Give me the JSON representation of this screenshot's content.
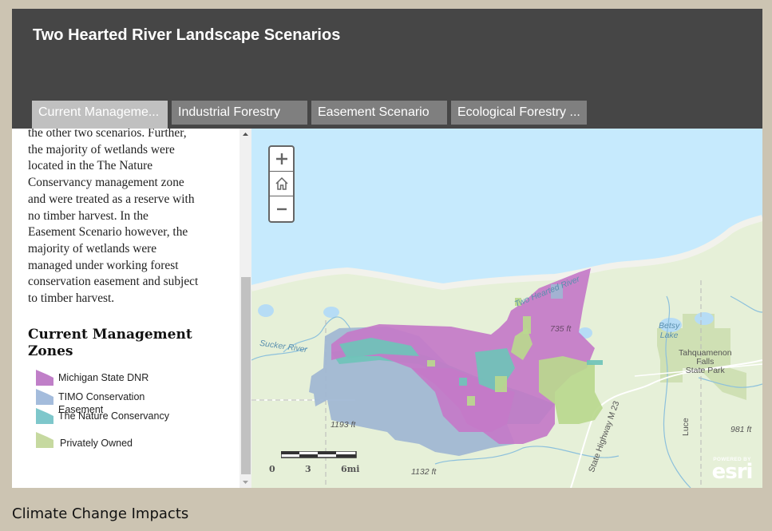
{
  "header": {
    "title": "Two Hearted River Landscape Scenarios"
  },
  "tabs": [
    {
      "label": "Current Manageme...",
      "active": true
    },
    {
      "label": "Industrial Forestry",
      "active": false
    },
    {
      "label": "Easement Scenario",
      "active": false
    },
    {
      "label": "Ecological Forestry ...",
      "active": false
    }
  ],
  "side_panel": {
    "narrative_lines": [
      "the other two scenarios.  Further,",
      "the majority of wetlands were",
      "located in the The Nature",
      "Conservancy management zone",
      "and were treated as a reserve with",
      "no timber harvest.  In the",
      "Easement Scenario however, the",
      "majority of wetlands were",
      "managed under working forest",
      "conservation easement and subject",
      "to timber harvest."
    ],
    "legend_title_line1": "Current Management",
    "legend_title_line2": "Zones",
    "legend": [
      {
        "label": "Michigan State DNR",
        "color": "#c07fc8"
      },
      {
        "label": "TIMO Conservation Easement",
        "color": "#a4bcdc"
      },
      {
        "label": "The Nature Conservancy",
        "color": "#7ec7cb"
      },
      {
        "label": "Privately Owned",
        "color": "#c6d9a0"
      }
    ],
    "scroll_position": 0.42
  },
  "map": {
    "zoom_in_icon": "plus-icon",
    "home_icon": "home-icon",
    "zoom_out_icon": "minus-icon",
    "labels": {
      "river_two_hearted": "Two Hearted River",
      "river_sucker": "Sucker River",
      "elev_735": "735 ft",
      "elev_1193": "1193 ft",
      "elev_1132": "1132 ft",
      "elev_981": "981 ft",
      "lake_betsy_1": "Betsy",
      "lake_betsy_2": "Lake",
      "park_1": "Tahquamenon",
      "park_2": "Falls",
      "park_3": "State Park",
      "county_luce": "Luce",
      "highway": "State Highway M 23"
    },
    "scale": {
      "label_0": "0",
      "label_3": "3",
      "label_6": "6mi"
    },
    "attribution": {
      "powered_by": "POWERED BY",
      "brand": "esri"
    },
    "colors": {
      "water": "#c6eafd",
      "land": "#e4efd6",
      "dnr": "#c479c8",
      "timo": "#9fb6d2",
      "tnc": "#6fc3b8",
      "private": "#bad88e"
    }
  },
  "section_heading": "Climate Change Impacts"
}
